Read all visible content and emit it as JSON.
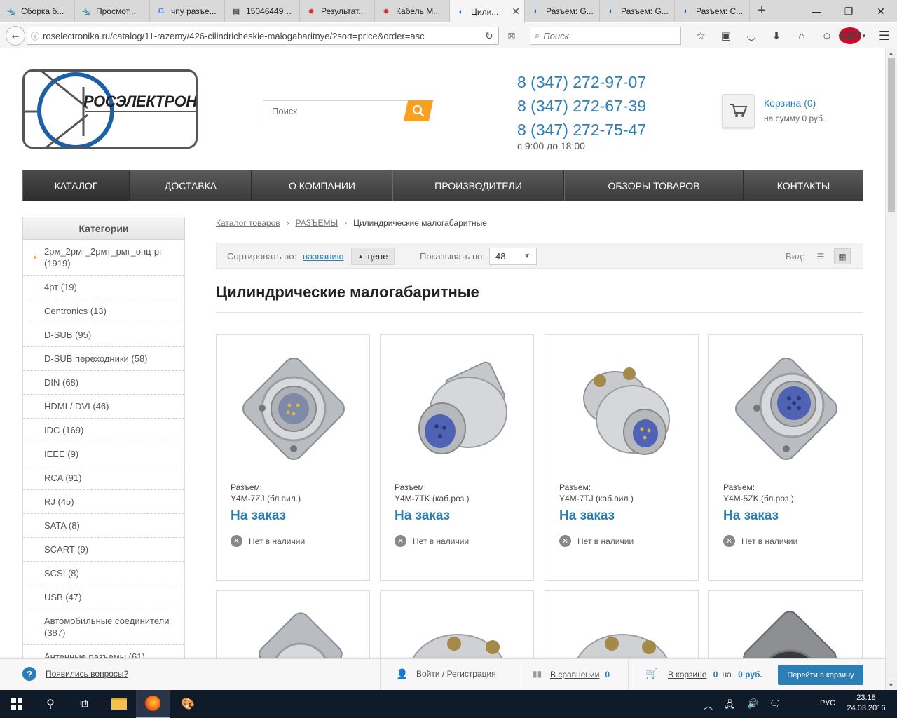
{
  "browser": {
    "tabs": [
      {
        "title": "Сборка б...",
        "icon": "chip-icon",
        "active": false
      },
      {
        "title": "Просмот...",
        "icon": "chip-icon",
        "active": false
      },
      {
        "title": "чпу разъе...",
        "icon": "google-icon",
        "active": false
      },
      {
        "title": "150464493...",
        "icon": "document-icon",
        "active": false
      },
      {
        "title": "Результат...",
        "icon": "red-star-icon",
        "active": false
      },
      {
        "title": "Кабель М...",
        "icon": "red-star-icon",
        "active": false
      },
      {
        "title": "Цили...",
        "icon": "site-icon",
        "active": true
      },
      {
        "title": "Разъем: G...",
        "icon": "site-icon",
        "active": false
      },
      {
        "title": "Разъем: G...",
        "icon": "site-icon",
        "active": false
      },
      {
        "title": "Разъем: С...",
        "icon": "site-icon",
        "active": false
      }
    ],
    "url": "roselectronika.ru/catalog/11-razemy/426-cilindricheskie-malogabaritnye/?sort=price&order=asc",
    "search_placeholder": "Поиск",
    "adblock_label": "ABP"
  },
  "site": {
    "logo_text": "РОСЭЛЕКТРОНИКА",
    "search_placeholder": "Поиск",
    "phones": [
      "8 (347) 272-97-07",
      "8 (347) 272-67-39",
      "8 (347) 272-75-47"
    ],
    "hours": "с 9:00 до 18:00",
    "cart_link": "Корзина (0)",
    "cart_sum": "на сумму 0 руб.",
    "menu": [
      "КАТАЛОГ",
      "ДОСТАВКА",
      "О КОМПАНИИ",
      "ПРОИЗВОДИТЕЛИ",
      "ОБЗОРЫ ТОВАРОВ",
      "КОНТАКТЫ"
    ]
  },
  "sidebar": {
    "title": "Категории",
    "items": [
      "2рм_2рмг_2рмт_рмг_онц-рг (1919)",
      "4рт (19)",
      "Centronics (13)",
      "D-SUB (95)",
      "D-SUB переходники (58)",
      "DIN (68)",
      "HDMI / DVI (46)",
      "IDC (169)",
      "IEEE (9)",
      "RCA (91)",
      "RJ (45)",
      "SATA (8)",
      "SCART (9)",
      "SCSI (8)",
      "USB (47)",
      "Автомобильные соединители (387)",
      "Антенные разъемы (61)"
    ]
  },
  "breadcrumb": {
    "catalog": "Каталог товаров",
    "section": "РАЗЪЕМЫ",
    "current": "Цилиндрические малогабаритные"
  },
  "sortbar": {
    "sort_label": "Сортировать по:",
    "sort_name": "названию",
    "sort_price": "цене",
    "show_label": "Показывать по:",
    "per_page": "48",
    "view_label": "Вид:"
  },
  "page_title": "Цилиндрические малогабаритные",
  "products": [
    {
      "line1": "Разъем:",
      "line2": "Y4M-7ZJ (бл.вил.)",
      "status": "На заказ",
      "stock": "Нет в наличии"
    },
    {
      "line1": "Разъем:",
      "line2": "Y4M-7TK (каб.роз.)",
      "status": "На заказ",
      "stock": "Нет в наличии"
    },
    {
      "line1": "Разъем:",
      "line2": "Y4M-7TJ (каб.вил.)",
      "status": "На заказ",
      "stock": "Нет в наличии"
    },
    {
      "line1": "Разъем:",
      "line2": "Y4M-5ZK (бл.роз.)",
      "status": "На заказ",
      "stock": "Нет в наличии"
    }
  ],
  "bottom_panel": {
    "questions": "Появились вопросы?",
    "login": "Войти / Регистрация",
    "compare_label": "В сравнении",
    "compare_count": "0",
    "cart_label": "В корзине",
    "cart_count": "0",
    "cart_on": "на",
    "cart_sum": "0 руб.",
    "go_cart": "Перейти в корзину"
  },
  "taskbar": {
    "lang": "РУС",
    "time": "23:18",
    "date": "24.03.2016"
  },
  "colors": {
    "link_blue": "#2b7fb5",
    "accent_orange": "#f7a11f",
    "menu_dark": "#3b3b3b"
  }
}
